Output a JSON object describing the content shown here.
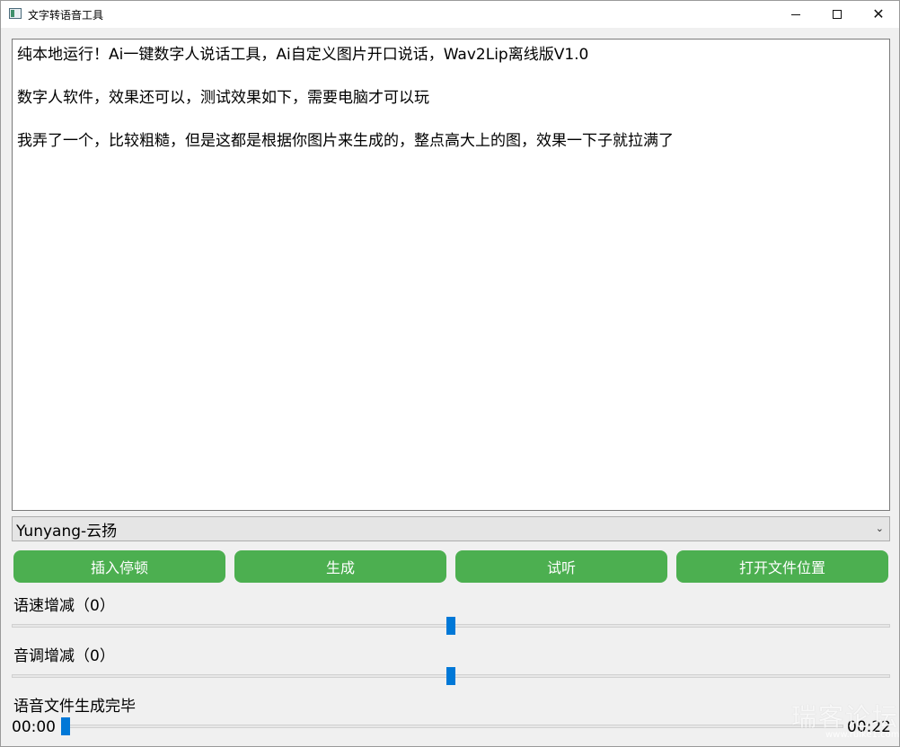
{
  "window": {
    "title": "文字转语音工具"
  },
  "editor": {
    "lines": [
      "纯本地运行！Ai一键数字人说话工具，Ai自定义图片开口说话，Wav2Lip离线版V1.0",
      "数字人软件，效果还可以，测试效果如下，需要电脑才可以玩",
      "我弄了一个，比较粗糙，但是这都是根据你图片来生成的，整点高大上的图，效果一下子就拉满了"
    ]
  },
  "voice": {
    "selected": "Yunyang-云扬"
  },
  "buttons": {
    "insert_pause": "插入停顿",
    "generate": "生成",
    "preview": "试听",
    "open_location": "打开文件位置"
  },
  "speed": {
    "label": "语速增减（0）",
    "value": 0
  },
  "pitch": {
    "label": "音调增减（0）",
    "value": 0
  },
  "status": {
    "text": "语音文件生成完毕"
  },
  "player": {
    "current_time": "00:00",
    "total_time": "00:22"
  },
  "watermark": {
    "text": "瑞客论坛",
    "sub": "www.ruike1.com"
  },
  "colors": {
    "button_bg": "#4caf50",
    "slider_handle": "#0078d7"
  }
}
